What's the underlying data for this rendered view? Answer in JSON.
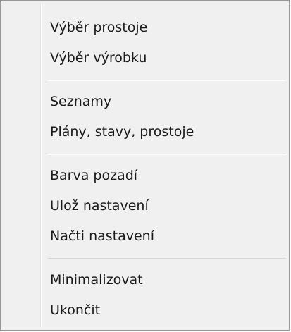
{
  "menu": {
    "groups": [
      {
        "items": [
          "Výběr prostoje",
          "Výběr výrobku"
        ]
      },
      {
        "items": [
          "Seznamy",
          "Plány, stavy, prostoje"
        ]
      },
      {
        "items": [
          "Barva pozadí",
          "Ulož nastavení",
          "Načti nastavení"
        ]
      },
      {
        "items": [
          "Minimalizovat",
          "Ukončit"
        ]
      }
    ]
  }
}
